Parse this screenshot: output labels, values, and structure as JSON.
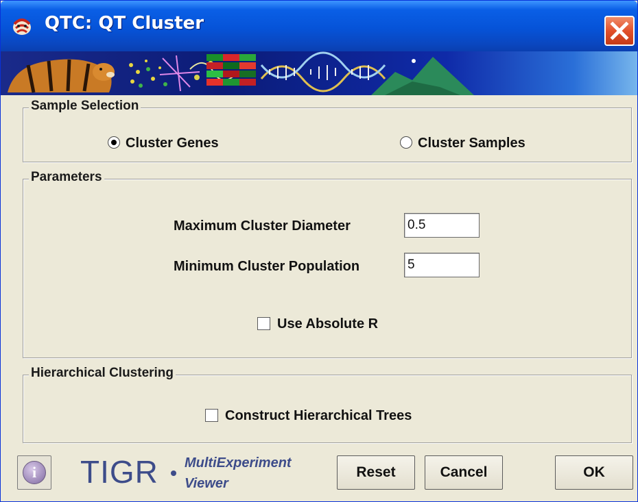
{
  "window": {
    "title": "QTC: QT Cluster",
    "title_icon": "tigr-app-icon",
    "close_icon": "close-x-icon"
  },
  "sample_selection": {
    "title": "Sample Selection",
    "options": [
      {
        "label": "Cluster Genes",
        "checked": true
      },
      {
        "label": "Cluster Samples",
        "checked": false
      }
    ]
  },
  "parameters": {
    "title": "Parameters",
    "max_diameter_label": "Maximum Cluster Diameter",
    "max_diameter_value": "0.5",
    "min_population_label": "Minimum Cluster Population",
    "min_population_value": "5",
    "absolute_r_label": "Use Absolute R",
    "absolute_r_checked": false
  },
  "hierarchical": {
    "title": "Hierarchical Clustering",
    "construct_trees_label": "Construct Hierarchical Trees",
    "construct_trees_checked": false
  },
  "footer": {
    "info_icon": "info-icon",
    "logo_text": "TIGR",
    "logo_sub_1": "MultiExperiment",
    "logo_sub_2": "Viewer",
    "reset_label": "Reset",
    "cancel_label": "Cancel",
    "ok_label": "OK"
  }
}
